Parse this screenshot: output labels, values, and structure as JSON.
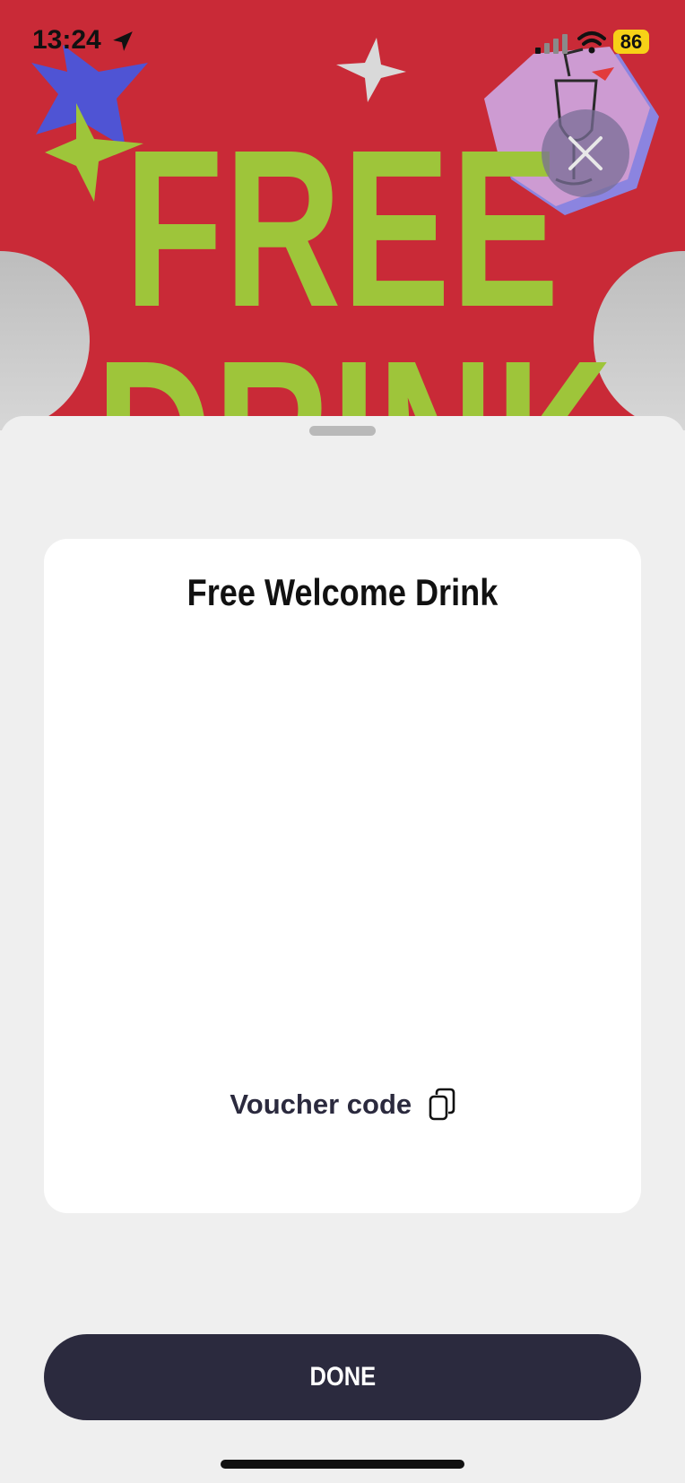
{
  "status_bar": {
    "time": "13:24",
    "battery": "86"
  },
  "hero": {
    "line1": "FREE",
    "line2": "DRINK",
    "background_color": "#c92a37",
    "text_color": "#9ec53a"
  },
  "card": {
    "title": "Free Welcome Drink",
    "voucher_label": "Voucher code"
  },
  "actions": {
    "done_label": "DONE"
  },
  "icons": {
    "location": "location-arrow-icon",
    "signal": "cellular-signal-icon",
    "wifi": "wifi-icon",
    "battery": "battery-icon",
    "close": "close-icon",
    "copy": "copy-icon"
  }
}
